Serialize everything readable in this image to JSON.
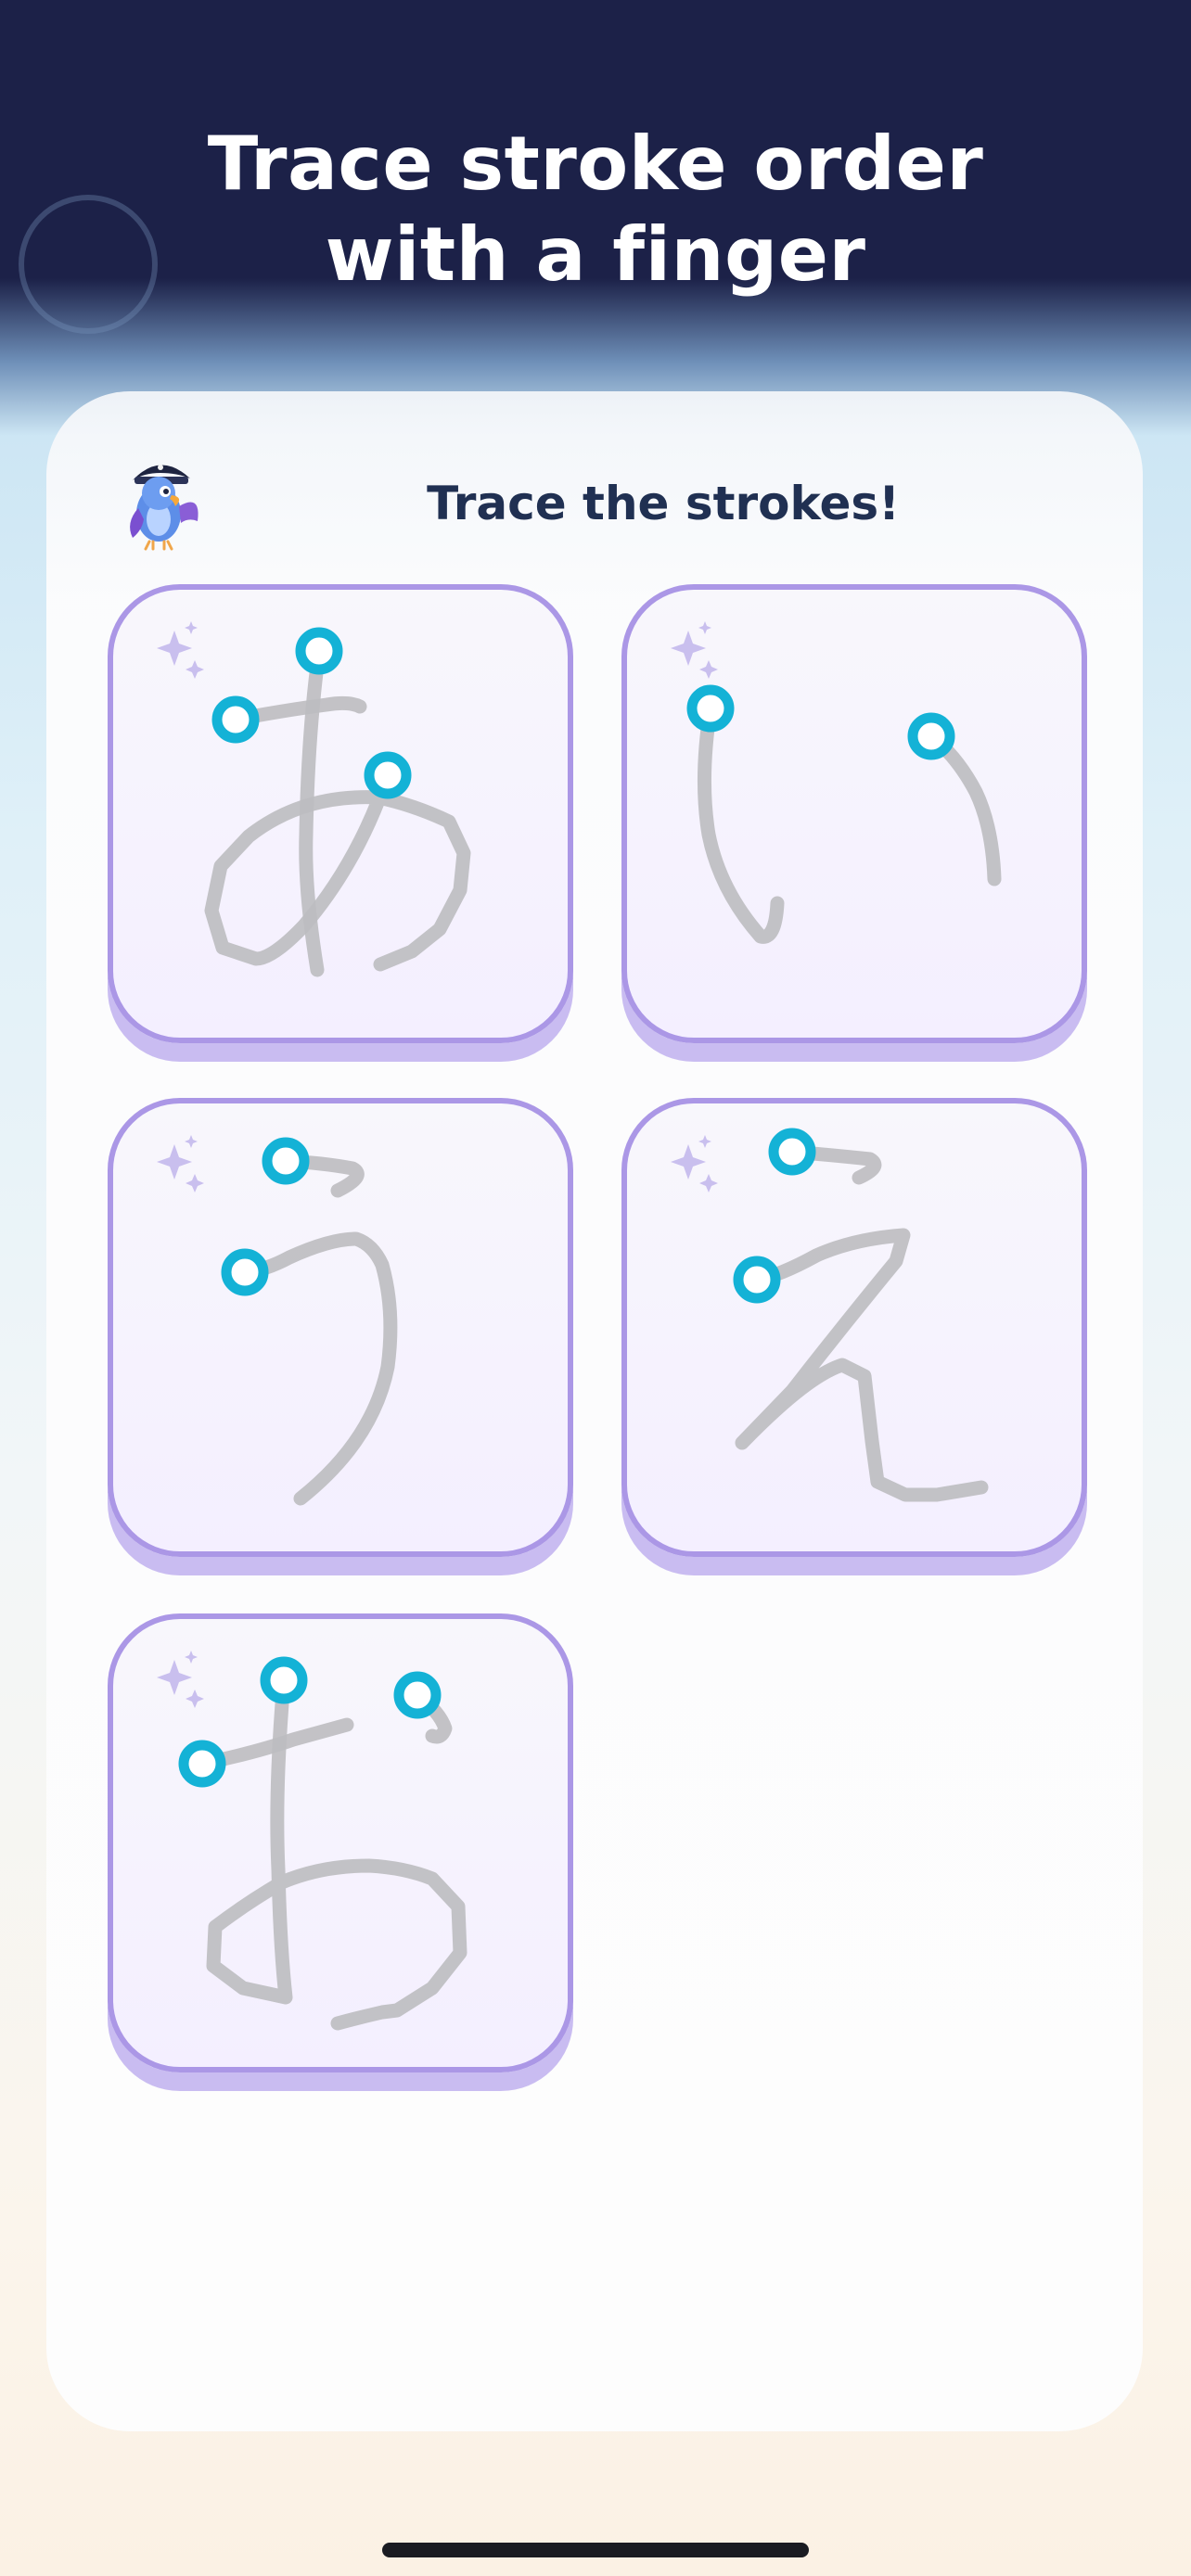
{
  "headline": {
    "line1": "Trace stroke order",
    "line2": "with a finger"
  },
  "panel": {
    "title": "Trace the strokes!",
    "mascot_icon": "pirate-parrot-mascot"
  },
  "cards": [
    {
      "character": "あ",
      "stroke_count": 3
    },
    {
      "character": "い",
      "stroke_count": 2
    },
    {
      "character": "う",
      "stroke_count": 2
    },
    {
      "character": "え",
      "stroke_count": 2
    },
    {
      "character": "お",
      "stroke_count": 3
    }
  ],
  "colors": {
    "header_background": "#1c2148",
    "card_border": "#ab97e6",
    "card_shadow": "#c9bcf1",
    "stroke_guide": "#bdbdc0",
    "start_marker": "#14b2d6",
    "title_text": "#203052"
  }
}
